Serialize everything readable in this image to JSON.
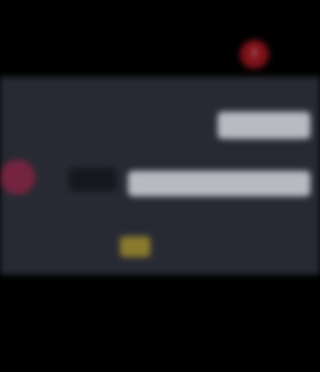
{
  "banner": {
    "title_line1": "",
    "title_line2": "",
    "icon_name": "alert-icon",
    "icon_glyph": "!"
  },
  "settings": {
    "row1_label": "",
    "row1_button": "",
    "row2_label": "",
    "avatar_initial": "",
    "dark_button": "",
    "wide_button": "",
    "hint_left": "",
    "hint_right": "",
    "footer_label": "",
    "badge_text": ""
  },
  "colors": {
    "background": "#000000",
    "panel": "#272a33",
    "accent_red": "#7e1219",
    "avatar": "#75243e",
    "badge": "#8a7a2e",
    "button_light": "#b8bac2"
  }
}
